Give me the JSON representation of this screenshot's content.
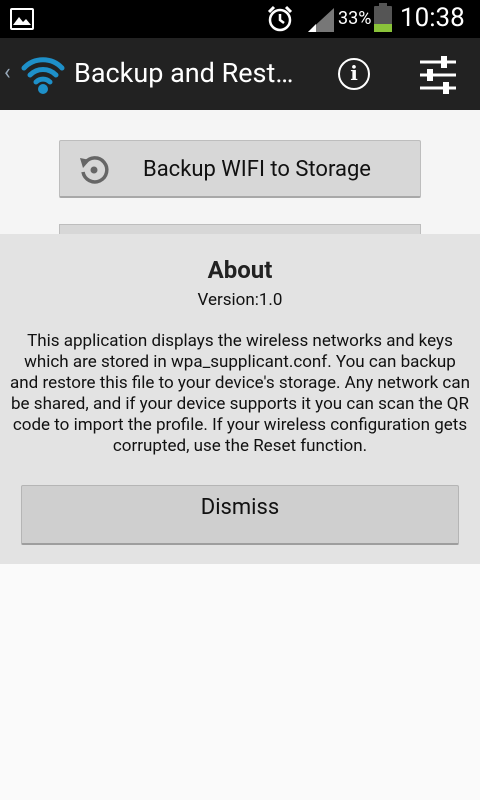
{
  "status_bar": {
    "battery_percent": "33%",
    "time": "10:38",
    "battery_level": 0.33,
    "icons": [
      "gallery-icon",
      "alarm-icon",
      "signal-icon",
      "battery-icon"
    ]
  },
  "action_bar": {
    "title": "Backup and Rest…",
    "up_glyph": "‹",
    "info_glyph": "i",
    "icons": [
      "wifi-logo-icon",
      "info-icon",
      "settings-sliders-icon"
    ]
  },
  "main": {
    "backup_button_label": "Backup WIFI to Storage"
  },
  "dialog": {
    "title": "About",
    "version": "Version:1.0",
    "body": "This application displays the wireless networks and keys which are stored in wpa_supplicant.conf. You can backup and restore this file to your device's storage. Any network can be shared, and if your device supports it you can scan the QR code to import the profile. If your wireless configuration gets corrupted, use the Reset function.",
    "dismiss_label": "Dismiss"
  },
  "colors": {
    "accent": "#1e90c9",
    "action_bar": "#222222",
    "battery_fill": "#8ac33a"
  }
}
